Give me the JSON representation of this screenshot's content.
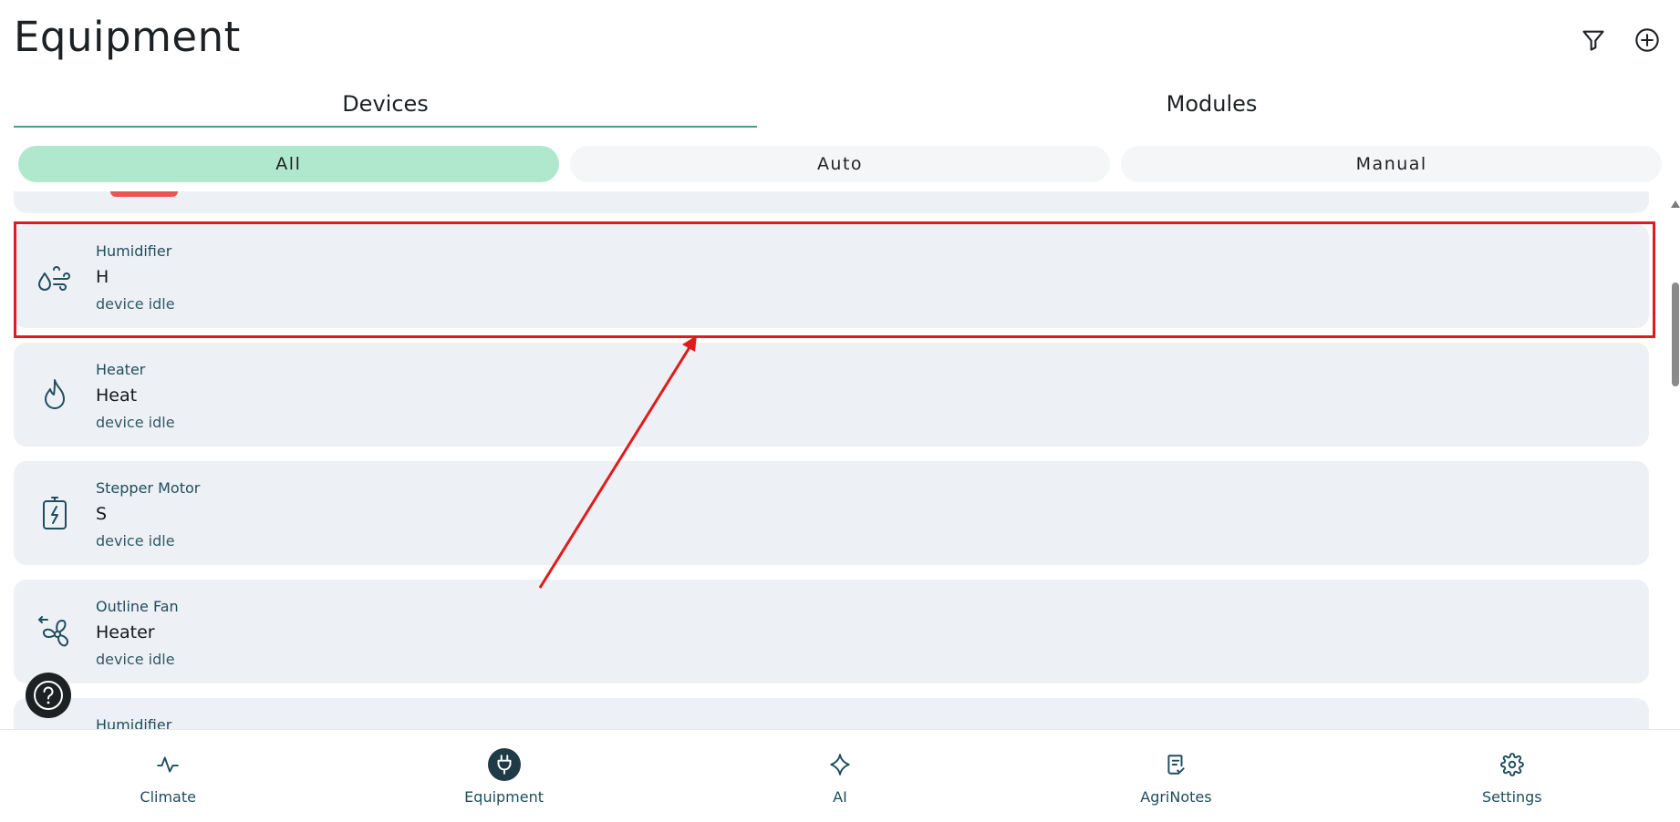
{
  "header": {
    "title": "Equipment"
  },
  "icons": {
    "filter": "filter-icon",
    "add": "add-circle-icon",
    "help": "help-icon"
  },
  "tabs": [
    {
      "label": "Devices",
      "active": true
    },
    {
      "label": "Modules",
      "active": false
    }
  ],
  "filters": [
    {
      "label": "All",
      "active": true
    },
    {
      "label": "Auto",
      "active": false
    },
    {
      "label": "Manual",
      "active": false
    }
  ],
  "devices": [
    {
      "type": "Humidifier",
      "name": "H",
      "status": "device idle",
      "icon": "humidifier-icon"
    },
    {
      "type": "Heater",
      "name": "Heat",
      "status": "device idle",
      "icon": "flame-icon"
    },
    {
      "type": "Stepper Motor",
      "name": "S",
      "status": "device idle",
      "icon": "battery-bolt-icon"
    },
    {
      "type": "Outline Fan",
      "name": "Heater",
      "status": "device idle",
      "icon": "fan-icon"
    },
    {
      "type": "Humidifier",
      "name": "",
      "status": "",
      "icon": "humidifier-icon"
    }
  ],
  "bottom_nav": [
    {
      "label": "Climate",
      "icon": "pulse-icon",
      "active": false
    },
    {
      "label": "Equipment",
      "icon": "plug-icon",
      "active": true
    },
    {
      "label": "AI",
      "icon": "sparkle-icon",
      "active": false
    },
    {
      "label": "AgriNotes",
      "icon": "notes-icon",
      "active": false
    },
    {
      "label": "Settings",
      "icon": "gear-icon",
      "active": false
    }
  ],
  "colors": {
    "accent": "#afe8cc",
    "highlight": "#e01b1b",
    "card": "#edf0f4",
    "icon": "#1f4e5f"
  }
}
